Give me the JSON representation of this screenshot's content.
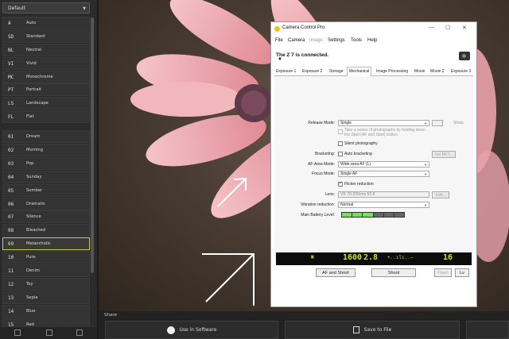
{
  "left_panel": {
    "preset_select": "Default",
    "picture_controls": [
      {
        "code": "A",
        "name": "Auto"
      },
      {
        "code": "SD",
        "name": "Standard"
      },
      {
        "code": "NL",
        "name": "Neutral"
      },
      {
        "code": "VI",
        "name": "Vivid"
      },
      {
        "code": "MC",
        "name": "Monochrome"
      },
      {
        "code": "PT",
        "name": "Portrait"
      },
      {
        "code": "LS",
        "name": "Landscape"
      },
      {
        "code": "FL",
        "name": "Flat"
      }
    ],
    "creative_controls": [
      {
        "code": "01",
        "name": "Dream"
      },
      {
        "code": "02",
        "name": "Morning"
      },
      {
        "code": "03",
        "name": "Pop"
      },
      {
        "code": "04",
        "name": "Sunday"
      },
      {
        "code": "05",
        "name": "Somber"
      },
      {
        "code": "06",
        "name": "Dramatic"
      },
      {
        "code": "07",
        "name": "Silence"
      },
      {
        "code": "08",
        "name": "Bleached"
      },
      {
        "code": "09",
        "name": "Melancholic"
      },
      {
        "code": "10",
        "name": "Pure"
      },
      {
        "code": "11",
        "name": "Denim"
      },
      {
        "code": "12",
        "name": "Toy"
      },
      {
        "code": "13",
        "name": "Sepia"
      },
      {
        "code": "14",
        "name": "Blue"
      },
      {
        "code": "15",
        "name": "Red"
      }
    ],
    "selected": "Melancholic",
    "selected_color": "#c8d22a"
  },
  "share": {
    "label": "Share",
    "use_in_software": "Use in Software",
    "save_to_file": "Save to File"
  },
  "ccp": {
    "title": "Camera Control Pro",
    "menu": [
      "File",
      "Camera",
      "Image",
      "Settings",
      "Tools",
      "Help"
    ],
    "status": "The Z 7 is connected.",
    "tabs": [
      "Exposure 1",
      "Exposure 2",
      "Storage",
      "Mechanical",
      "Image Processing",
      "Movie",
      "Movie 2",
      "Exposure 3"
    ],
    "active_tab": "Mechanical",
    "release_mode_label": "Release Mode:",
    "release_mode_value": "Single",
    "shots_label": "Shots",
    "take_series_text": "Take a series of photographs by holding down the Start (AF and Start) button",
    "silent_photography": "Silent photography",
    "bracketing_label": "Bracketing:",
    "auto_bracketing": "Auto bracketing",
    "set_btn": "Set BKT...",
    "af_area_label": "AF-Area Mode:",
    "af_area_value": "Wide-area AF (L)",
    "focus_mode_label": "Focus Mode:",
    "focus_mode_value": "Single AF",
    "flicker_reduction": "Flicker reduction",
    "lens_label": "Lens:",
    "lens_value": "VR 70-200mm f/2.8",
    "edit_btn": "Edit...",
    "vr_label": "Vibration reduction:",
    "vr_value": "Normal",
    "battery_label": "Main Battery Level:",
    "battery_level": 0.5,
    "battery_color": "#7fd86a",
    "lcd_shutter": "1600",
    "lcd_aperture": "2.8",
    "lcd_frames": "16",
    "af_and_shoot": "AF and Shoot",
    "shoot": "Shoot",
    "flash": "Flash",
    "lv": "Lv"
  }
}
